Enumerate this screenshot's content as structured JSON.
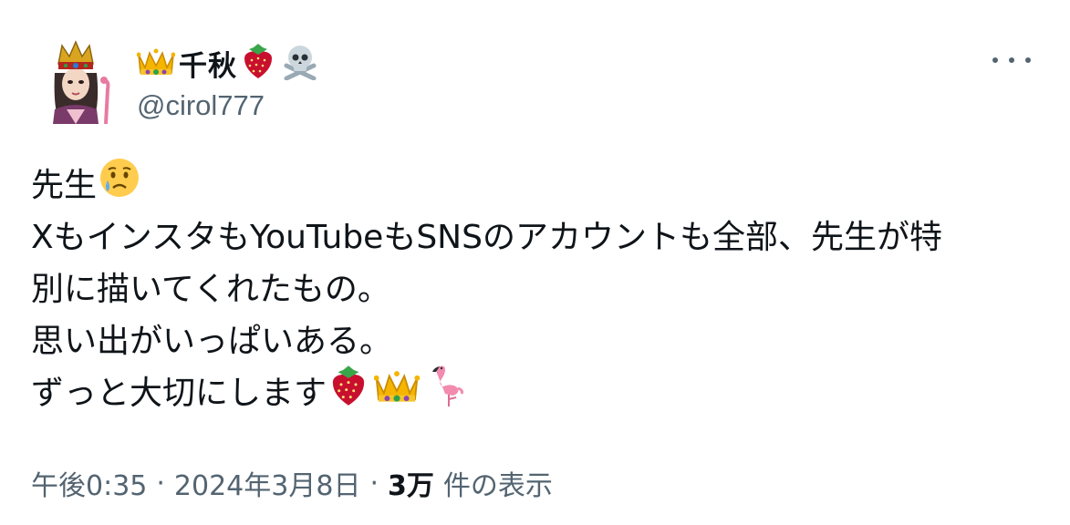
{
  "author": {
    "display_name": "千秋",
    "handle": "@cirol777",
    "name_icons": [
      "crown-icon",
      "strawberry-icon",
      "skull-crossbones-icon"
    ]
  },
  "tweet": {
    "lines": [
      "先生",
      "XもインスタもYouTubeもSNSのアカウントも全部、先生が特",
      "別に描いてくれたもの。",
      "思い出がいっぱいある。",
      "ずっと大切にします"
    ],
    "line1_icon": "crying-face-icon",
    "line5_icons": [
      "strawberry-icon",
      "crown-icon",
      "flamingo-icon"
    ]
  },
  "meta": {
    "time": "午後0:35",
    "separator": "·",
    "date": "2024年3月8日",
    "views_count": "3万",
    "views_label": "件の表示"
  },
  "colors": {
    "text": "#0f1419",
    "secondary": "#536471",
    "background": "#ffffff"
  }
}
